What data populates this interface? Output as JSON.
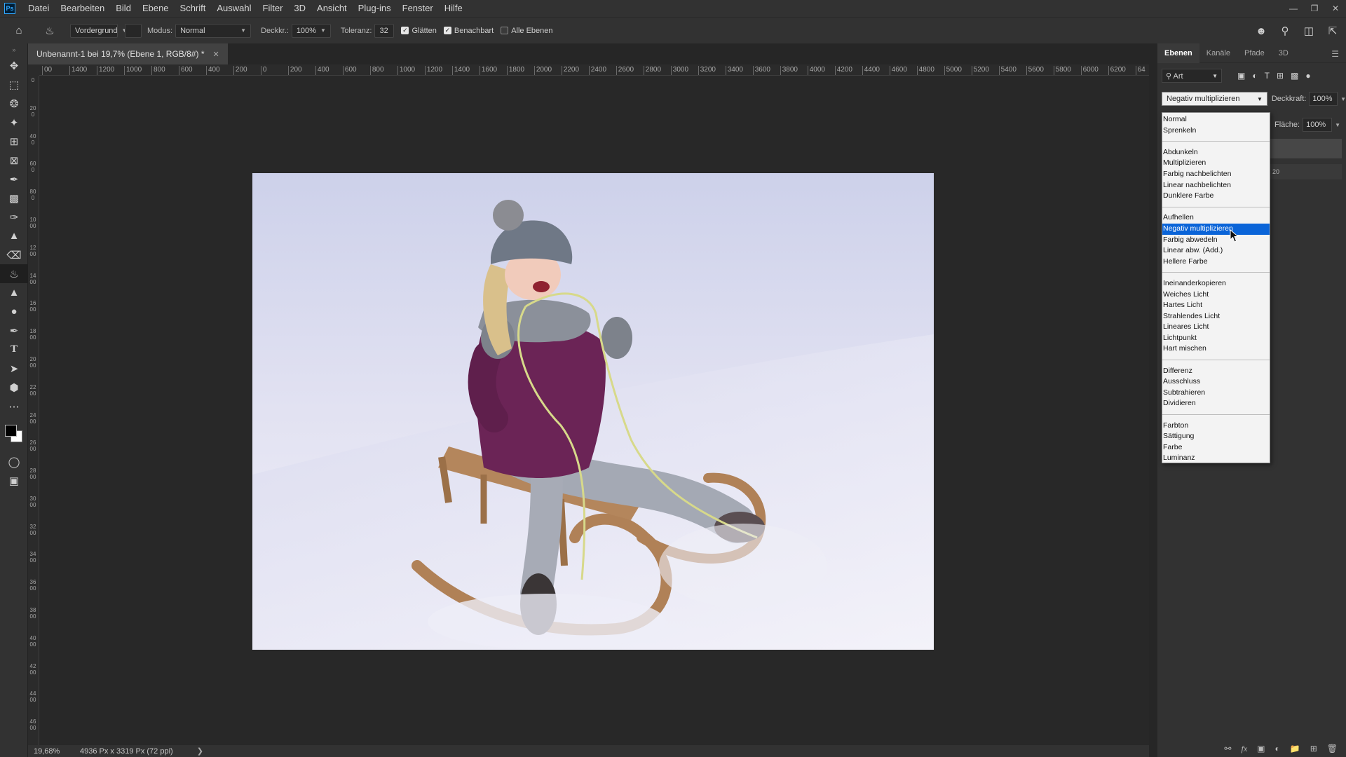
{
  "app": {
    "logo": "Ps"
  },
  "menu": [
    "Datei",
    "Bearbeiten",
    "Bild",
    "Ebene",
    "Schrift",
    "Auswahl",
    "Filter",
    "3D",
    "Ansicht",
    "Plug-ins",
    "Fenster",
    "Hilfe"
  ],
  "options": {
    "fill_source": "Vordergrund",
    "mode_label": "Modus:",
    "mode_value": "Normal",
    "opacity_label": "Deckkr.:",
    "opacity_value": "100%",
    "tolerance_label": "Toleranz:",
    "tolerance_value": "32",
    "antialias_label": "Glätten",
    "contiguous_label": "Benachbart",
    "all_layers_label": "Alle Ebenen"
  },
  "document": {
    "tab_title": "Unbenannt-1 bei 19,7% (Ebene 1, RGB/8#) *",
    "zoom": "19,68%",
    "size_info": "4936 Px x 3319 Px (72 ppi)"
  },
  "ruler_top": [
    "00",
    "1400",
    "1200",
    "1000",
    "800",
    "600",
    "400",
    "200",
    "0",
    "200",
    "400",
    "600",
    "800",
    "1000",
    "1200",
    "1400",
    "1600",
    "1800",
    "2000",
    "2200",
    "2400",
    "2600",
    "2800",
    "3000",
    "3200",
    "3400",
    "3600",
    "3800",
    "4000",
    "4200",
    "4400",
    "4600",
    "4800",
    "5000",
    "5200",
    "5400",
    "5600",
    "5800",
    "6000",
    "6200",
    "64"
  ],
  "ruler_left": [
    "0",
    "200",
    "400",
    "600",
    "800",
    "1000",
    "1200",
    "1400",
    "1600",
    "1800",
    "2000",
    "2200",
    "2400",
    "2600",
    "2800",
    "3000",
    "3200",
    "3400",
    "3600",
    "3800",
    "4000",
    "4200",
    "4400",
    "4600"
  ],
  "layers_panel": {
    "tabs": [
      "Ebenen",
      "Kanäle",
      "Pfade",
      "3D"
    ],
    "filter_value": "Art",
    "blend_value": "Negativ multiplizieren",
    "opacity_label": "Deckkraft:",
    "opacity_value": "100%",
    "fill_label": "Fläche:",
    "fill_value": "100%",
    "partial_text": "20"
  },
  "blend_modes": [
    [
      "Normal",
      "Sprenkeln"
    ],
    [
      "Abdunkeln",
      "Multiplizieren",
      "Farbig nachbelichten",
      "Linear nachbelichten",
      "Dunklere Farbe"
    ],
    [
      "Aufhellen",
      "Negativ multiplizieren",
      "Farbig abwedeln",
      "Linear abw. (Add.)",
      "Hellere Farbe"
    ],
    [
      "Ineinanderkopieren",
      "Weiches Licht",
      "Hartes Licht",
      "Strahlendes Licht",
      "Lineares Licht",
      "Lichtpunkt",
      "Hart mischen"
    ],
    [
      "Differenz",
      "Ausschluss",
      "Subtrahieren",
      "Dividieren"
    ],
    [
      "Farbton",
      "Sättigung",
      "Farbe",
      "Luminanz"
    ]
  ],
  "selected_blend_mode": "Negativ multiplizieren",
  "colors": {
    "foreground": "#000000",
    "background": "#ffffff",
    "highlight": "#0a64d8"
  }
}
